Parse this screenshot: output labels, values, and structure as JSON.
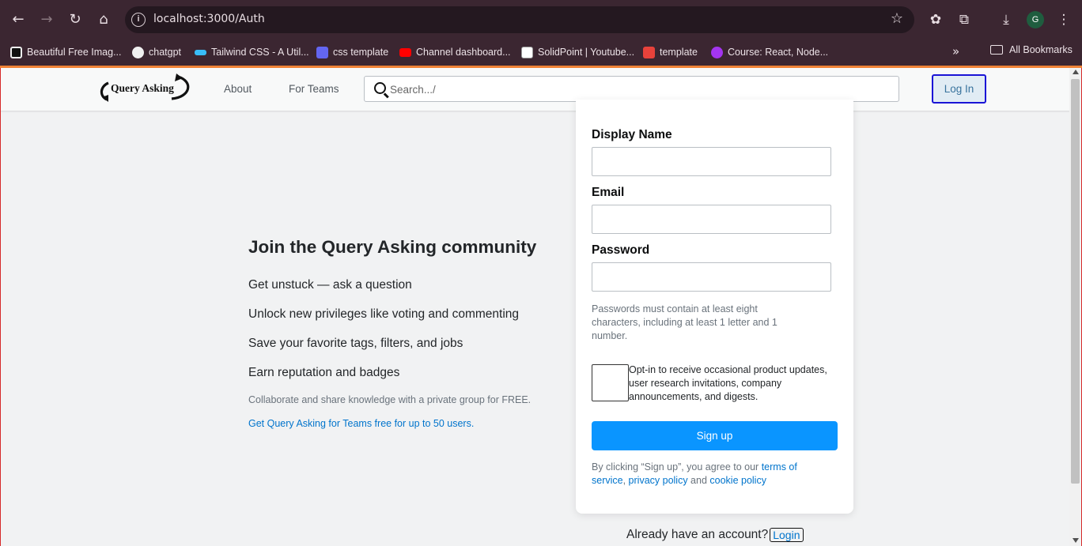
{
  "browser": {
    "url": "localhost:3000/Auth",
    "profile_initial": "G",
    "bookmarks": [
      {
        "label": "Beautiful Free Imag...",
        "color": "#111111"
      },
      {
        "label": "chatgpt",
        "color": "#f0f0f0"
      },
      {
        "label": "Tailwind CSS - A Util...",
        "color": "#38bdf8"
      },
      {
        "label": "css template",
        "color": "#6366f1"
      },
      {
        "label": "Channel dashboard...",
        "color": "#ff0000"
      },
      {
        "label": "SolidPoint | Youtube...",
        "color": "#ffffff"
      },
      {
        "label": "template",
        "color": "#e8423b"
      },
      {
        "label": "Course: React, Node...",
        "color": "#a435f0"
      }
    ],
    "all_bookmarks_label": "All Bookmarks"
  },
  "navbar": {
    "logo_text": "Query Asking",
    "links": [
      "About",
      "For Teams"
    ],
    "search_placeholder": "Search.../",
    "login_label": "Log In"
  },
  "intro": {
    "title": "Join the Query Asking community",
    "benefits": [
      "Get unstuck — ask a question",
      "Unlock new privileges like voting and commenting",
      "Save your favorite tags, filters, and jobs",
      "Earn reputation and badges"
    ],
    "collab_text": "Collaborate and share knowledge with a private group for FREE.",
    "teams_link": "Get Query Asking for Teams free for up to 50 users."
  },
  "form": {
    "display_name_label": "Display Name",
    "email_label": "Email",
    "password_label": "Password",
    "password_hint": "Passwords must contain at least eight characters, including at least 1 letter and 1 number.",
    "opt_in_text": "Opt-in to receive occasional product updates, user research invitations, company announcements, and digests.",
    "signup_label": "Sign up",
    "terms_prefix": "By clicking “Sign up”, you agree to our ",
    "terms_link": "terms of service",
    "terms_comma": ", ",
    "privacy_link": "privacy policy",
    "terms_and": " and ",
    "cookie_link": "cookie policy"
  },
  "footer": {
    "already_text": "Already have an account?",
    "login_link": "Login"
  }
}
